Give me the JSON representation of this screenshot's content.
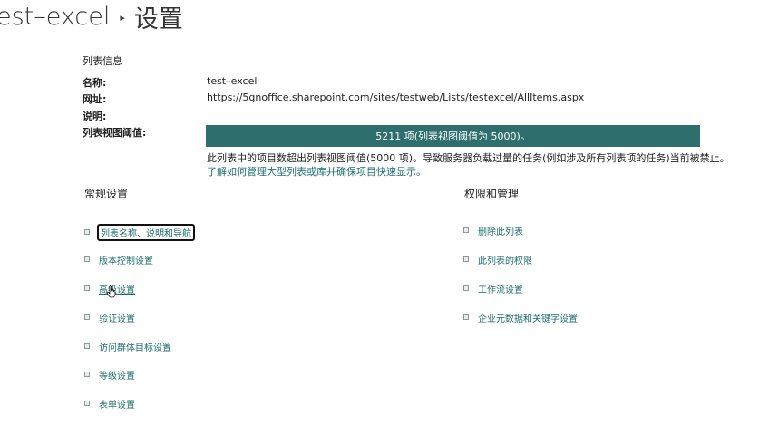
{
  "breadcrumb": {
    "list_name": "est–excel",
    "page": "设置"
  },
  "list_info": {
    "heading": "列表信息",
    "name_label": "名称:",
    "name_value": "test–excel",
    "url_label": "网址:",
    "url_value": "https://5gnoffice.sharepoint.com/sites/testweb/Lists/testexcel/AllItems.aspx",
    "desc_label": "说明:",
    "threshold_label": "列表视图阈值:",
    "threshold_bar": "5211 项(列表视图阈值为 5000)。",
    "threshold_note": "此列表中的项目数超出列表视图阈值(5000 项)。导致服务器负载过量的任务(例如涉及所有列表项的任务)当前被禁止。",
    "threshold_link": "了解如何管理大型列表或库并确保项目快速显示。"
  },
  "general": {
    "heading": "常规设置",
    "items": [
      "列表名称、说明和导航",
      "版本控制设置",
      "高级设置",
      "验证设置",
      "访问群体目标设置",
      "等级设置",
      "表单设置"
    ]
  },
  "permissions": {
    "heading": "权限和管理",
    "items": [
      "删除此列表",
      "此列表的权限",
      "工作流设置",
      "企业元数据和关键字设置"
    ]
  },
  "colors": {
    "accent": "#2e6f6e",
    "link": "#1f6f70"
  }
}
